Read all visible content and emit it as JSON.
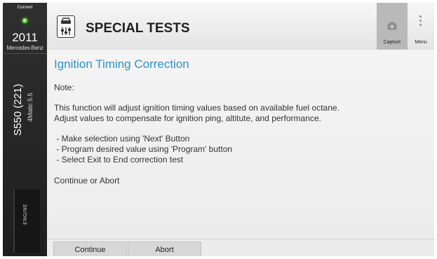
{
  "sidebar": {
    "current_label": "Current",
    "year": "2011",
    "make": "Mercedes-Benz",
    "model": "S550 (221)",
    "sub_model": "4Matic 5.5",
    "system_tab": "ENGINE",
    "status_color": "#4ccc24"
  },
  "header": {
    "title": "SPECIAL TESTS",
    "icon": "car-settings-icon",
    "capture_label": "Capture",
    "menu_label": "Menu"
  },
  "content": {
    "title": "Ignition Timing Correction",
    "note_label": "Note:",
    "description_line1": "This function will adjust ignition timing values based on available fuel octane.",
    "description_line2": "Adjust values to compensate for ignition ping, altitute, and performance.",
    "instructions": [
      " - Make selection using 'Next' Button",
      " - Program desired value using 'Program' button",
      " - Select Exit to End correction test"
    ],
    "prompt": "Continue or Abort",
    "title_color": "#2e93c8"
  },
  "footer": {
    "continue_label": "Continue",
    "abort_label": "Abort"
  }
}
